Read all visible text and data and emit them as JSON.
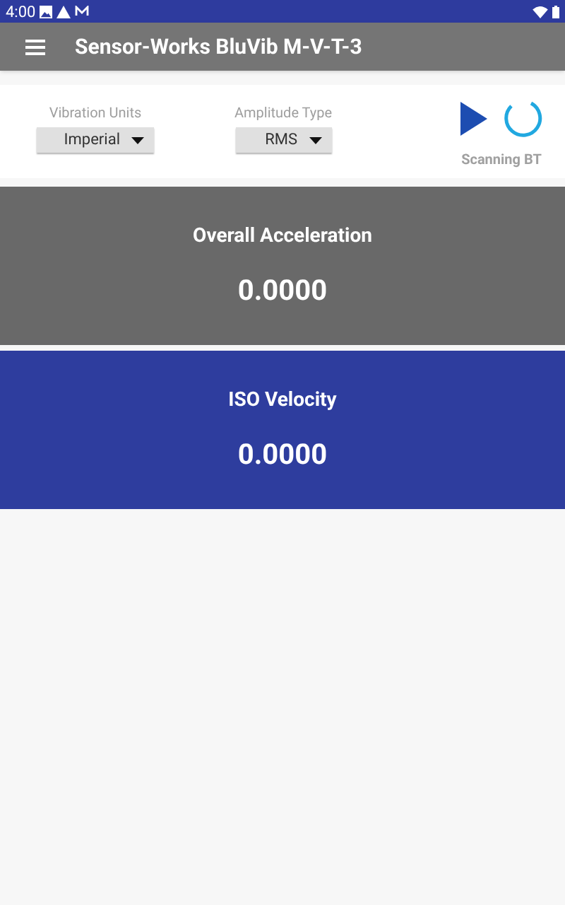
{
  "status_bar": {
    "time": "4:00"
  },
  "app_bar": {
    "title": "Sensor-Works BluVib M-V-T-3"
  },
  "controls": {
    "dropdowns": [
      {
        "label": "Vibration Units",
        "value": "Imperial"
      },
      {
        "label": "Amplitude Type",
        "value": "RMS"
      }
    ],
    "scan_status": "Scanning BT"
  },
  "readings": [
    {
      "title": "Overall Acceleration",
      "value": "0.0000",
      "color": "#696969"
    },
    {
      "title": "ISO Velocity",
      "value": "0.0000",
      "color": "#2e3d9e"
    }
  ]
}
